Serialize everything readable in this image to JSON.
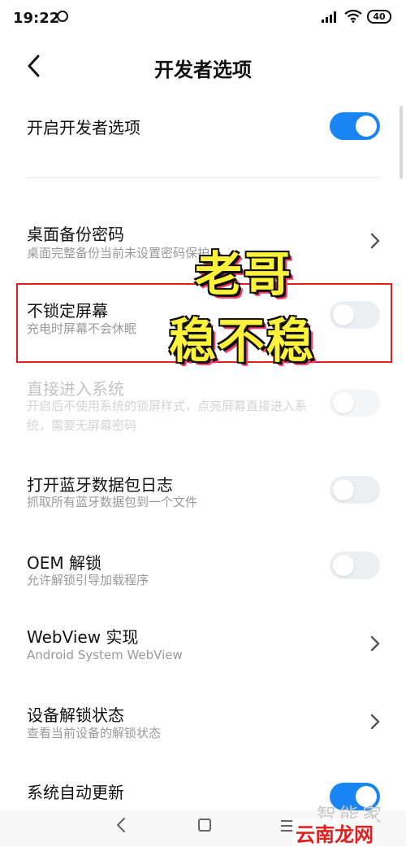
{
  "status_bar": {
    "time": "19:22",
    "battery": "40"
  },
  "header": {
    "title": "开发者选项"
  },
  "settings": [
    {
      "title": "开启开发者选项",
      "control": "toggle-on"
    },
    {
      "title": "桌面备份密码",
      "subtitle": "桌面完整备份当前未设置密码保护",
      "control": "chevron"
    },
    {
      "title": "不锁定屏幕",
      "subtitle": "充电时屏幕不会休眠",
      "control": "toggle-off"
    },
    {
      "title": "直接进入系统",
      "subtitle": "开启后不使用系统的锁屏样式，点亮屏幕直接进入系统，需要无屏幕密码",
      "control": "toggle-off",
      "disabled": true
    },
    {
      "title": "打开蓝牙数据包日志",
      "subtitle": "抓取所有蓝牙数据包到一个文件",
      "control": "toggle-off"
    },
    {
      "title": "OEM 解锁",
      "subtitle": "允许解锁引导加载程序",
      "control": "toggle-off"
    },
    {
      "title": "WebView 实现",
      "subtitle": "Android System WebView",
      "control": "chevron"
    },
    {
      "title": "设备解锁状态",
      "subtitle": "查看当前设备的解锁状态",
      "control": "chevron"
    },
    {
      "title": "系统自动更新",
      "control": "toggle-on"
    }
  ],
  "overlay": {
    "line1": "老哥",
    "line2": "稳不稳"
  },
  "watermark": {
    "top": "智能家",
    "bottom": "云南龙网"
  },
  "colors": {
    "accent": "#1a86f4",
    "highlight": "#e02020",
    "overlay": "#fff23a"
  }
}
